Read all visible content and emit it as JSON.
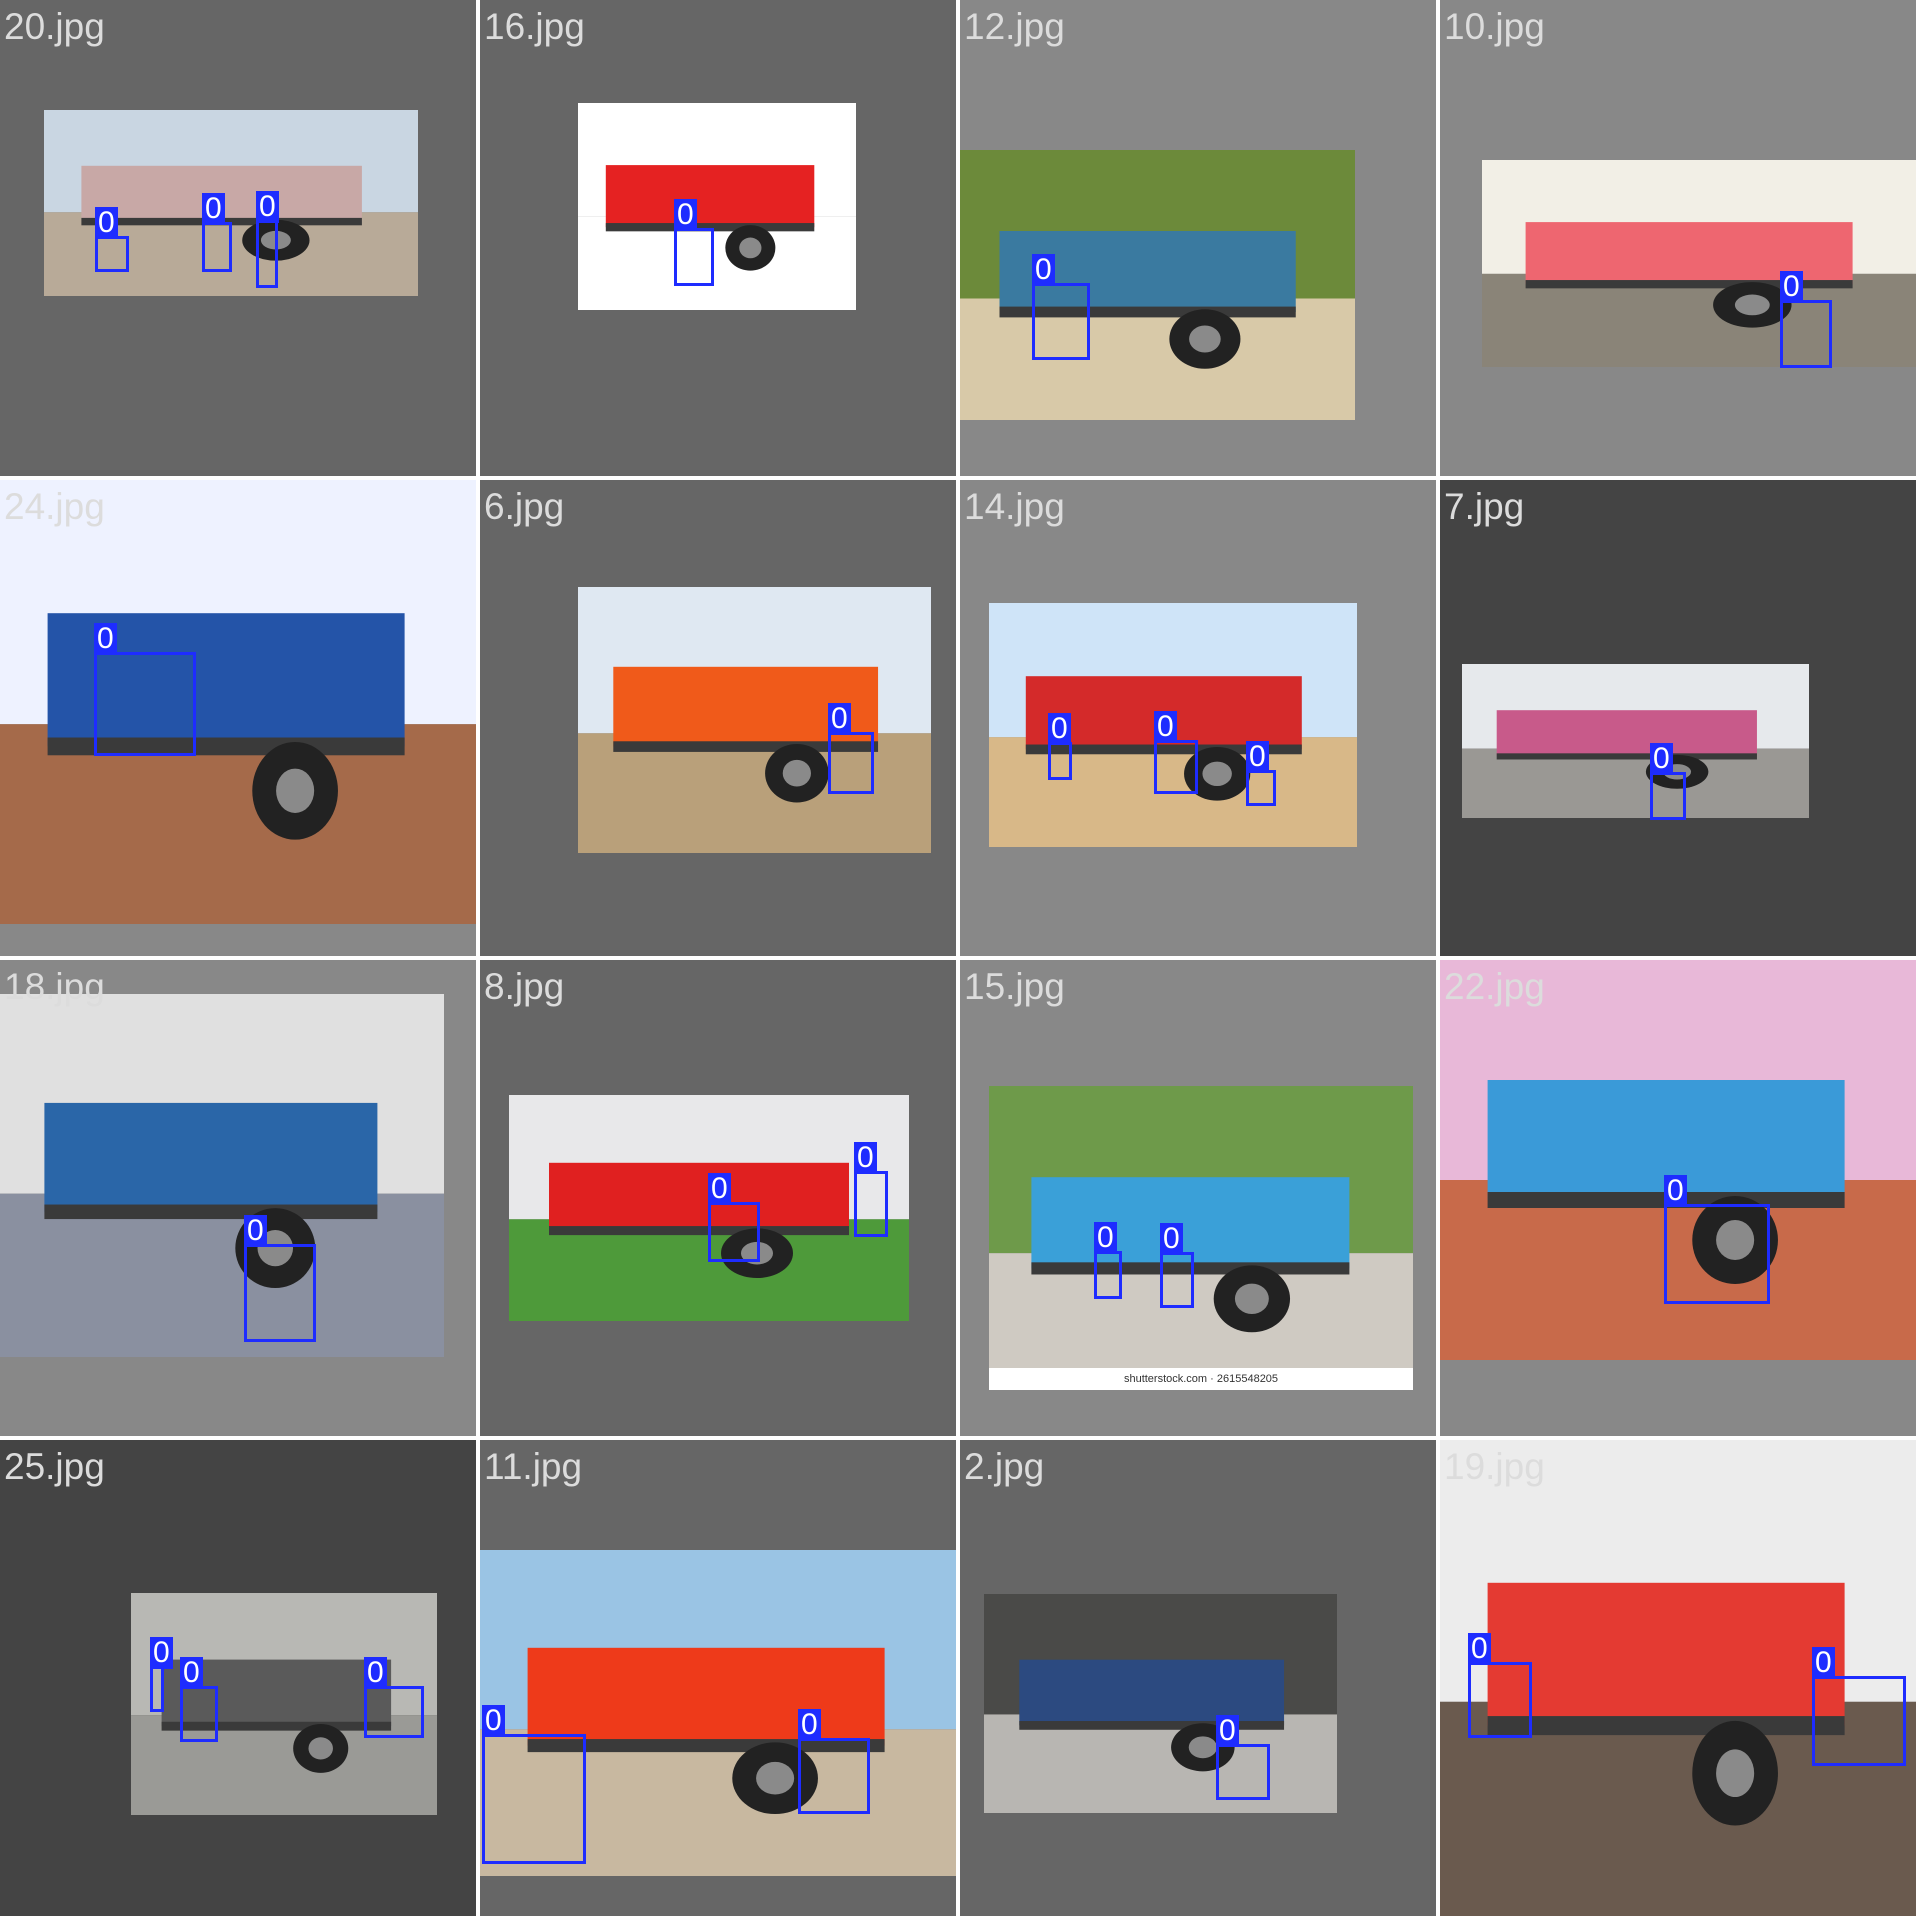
{
  "mosaic": {
    "colors": {
      "box": "#1e2cff",
      "label_text": "#dcdcdc",
      "tag_text": "#ffffff"
    },
    "tiles": [
      {
        "name": "20.jpg",
        "bg": "#666666",
        "photo": {
          "sky": "#c9d6e2",
          "ground": "#b8aa98",
          "body": "#c8a8a6"
        },
        "boxes": [
          {
            "label": "0"
          },
          {
            "label": "0"
          },
          {
            "label": "0"
          }
        ]
      },
      {
        "name": "16.jpg",
        "bg": "#666666",
        "photo": {
          "sky": "#ffffff",
          "ground": "#ffffff",
          "body": "#e52222"
        },
        "boxes": [
          {
            "label": "0"
          }
        ]
      },
      {
        "name": "12.jpg",
        "bg": "#888888",
        "photo": {
          "sky": "#6c8a3a",
          "ground": "#d8c9a8",
          "body": "#3a7aa0"
        },
        "boxes": [
          {
            "label": "0"
          }
        ]
      },
      {
        "name": "10.jpg",
        "bg": "#888888",
        "photo": {
          "sky": "#f2efe6",
          "ground": "#8a8478",
          "body": "#ee6670"
        },
        "boxes": [
          {
            "label": "0"
          }
        ]
      },
      {
        "name": "24.jpg",
        "bg": "#888888",
        "photo": {
          "sky": "#eef2ff",
          "ground": "#a56a4a",
          "body": "#2454a8"
        },
        "boxes": [
          {
            "label": "0"
          }
        ]
      },
      {
        "name": "6.jpg",
        "bg": "#666666",
        "photo": {
          "sky": "#dfe8f2",
          "ground": "#b9a07a",
          "body": "#f05a1a"
        },
        "boxes": [
          {
            "label": "0"
          }
        ]
      },
      {
        "name": "14.jpg",
        "bg": "#888888",
        "photo": {
          "sky": "#cfe4f8",
          "ground": "#d8b888",
          "body": "#d42a2a"
        },
        "boxes": [
          {
            "label": "0"
          },
          {
            "label": "0"
          },
          {
            "label": "0"
          }
        ]
      },
      {
        "name": "7.jpg",
        "bg": "#444444",
        "photo": {
          "sky": "#e6e9ec",
          "ground": "#9a9894",
          "body": "#c85a8a"
        },
        "boxes": [
          {
            "label": "0"
          }
        ]
      },
      {
        "name": "18.jpg",
        "bg": "#888888",
        "photo": {
          "sky": "#e0e0e0",
          "ground": "#8a90a0",
          "body": "#2a66a8"
        },
        "boxes": [
          {
            "label": "0"
          }
        ]
      },
      {
        "name": "8.jpg",
        "bg": "#666666",
        "photo": {
          "sky": "#e8e8ea",
          "ground": "#4e9a3a",
          "body": "#e02020"
        },
        "boxes": [
          {
            "label": "0"
          },
          {
            "label": "0"
          }
        ]
      },
      {
        "name": "15.jpg",
        "bg": "#888888",
        "photo": {
          "sky": "#6e9a4a",
          "ground": "#cfcac2",
          "body": "#3aa0d8"
        },
        "footer_text": "shutterstock.com · 2615548205",
        "boxes": [
          {
            "label": "0"
          },
          {
            "label": "0"
          }
        ]
      },
      {
        "name": "22.jpg",
        "bg": "#888888",
        "photo": {
          "sky": "#e8b8d8",
          "ground": "#c86a4a",
          "body": "#3a9ad8"
        },
        "boxes": [
          {
            "label": "0"
          }
        ]
      },
      {
        "name": "25.jpg",
        "bg": "#444444",
        "photo": {
          "sky": "#b8b8b4",
          "ground": "#9a9a96",
          "body": "#5a5a5a"
        },
        "boxes": [
          {
            "label": "0"
          },
          {
            "label": "0"
          },
          {
            "label": "0"
          }
        ]
      },
      {
        "name": "11.jpg",
        "bg": "#666666",
        "photo": {
          "sky": "#9ac4e4",
          "ground": "#c8b8a0",
          "body": "#ee3a1a"
        },
        "boxes": [
          {
            "label": "0"
          },
          {
            "label": "0"
          }
        ]
      },
      {
        "name": "2.jpg",
        "bg": "#666666",
        "photo": {
          "sky": "#4a4a48",
          "ground": "#b8b6b2",
          "body": "#2c4a80"
        },
        "boxes": [
          {
            "label": "0"
          }
        ]
      },
      {
        "name": "19.jpg",
        "bg": "#888888",
        "photo": {
          "sky": "#ececec",
          "ground": "#6a5a4e",
          "body": "#e43a32"
        },
        "boxes": [
          {
            "label": "0"
          },
          {
            "label": "0"
          }
        ]
      }
    ]
  }
}
